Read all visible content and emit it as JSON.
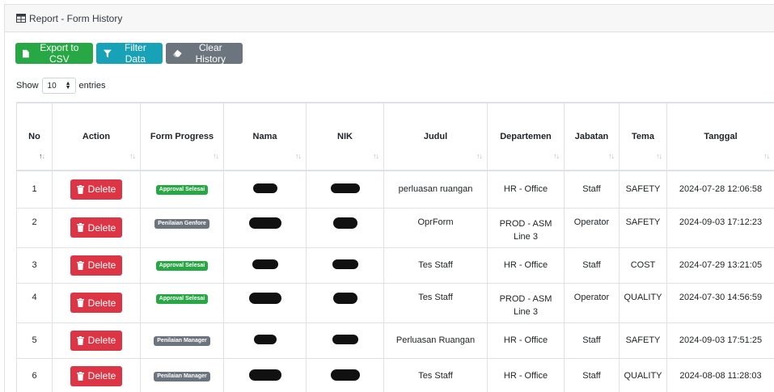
{
  "header": {
    "title": "Report - Form History",
    "icon": "table-icon"
  },
  "toolbar": {
    "export_label": "Export to CSV",
    "filter_label": "Filter Data",
    "clear_label": "Clear History",
    "colors": {
      "export": "#28a745",
      "filter": "#17a2b8",
      "clear": "#6c757d"
    }
  },
  "length": {
    "show": "Show",
    "value": "10",
    "entries": "entries"
  },
  "table": {
    "columns": [
      "No",
      "Action",
      "Form Progress",
      "Nama",
      "NIK",
      "Judul",
      "Departemen",
      "Jabatan",
      "Tema",
      "Tanggal"
    ],
    "delete_label": "Delete",
    "rows": [
      {
        "no": "1",
        "progress": "Approval Selesai",
        "status": "success",
        "judul": "perluasan ruangan",
        "dept1": "HR - Office",
        "dept2": "",
        "jabatan": "Staff",
        "tema": "SAFETY",
        "tanggal": "2024-07-28 12:06:58"
      },
      {
        "no": "2",
        "progress": "Penilaian Genfore",
        "status": "secondary",
        "judul": "OprForm",
        "dept1": "PROD - ASM",
        "dept2": "Line 3",
        "jabatan": "Operator",
        "tema": "SAFETY",
        "tanggal": "2024-09-03 17:12:23"
      },
      {
        "no": "3",
        "progress": "Approval Selesai",
        "status": "success",
        "judul": "Tes Staff",
        "dept1": "HR - Office",
        "dept2": "",
        "jabatan": "Staff",
        "tema": "COST",
        "tanggal": "2024-07-29 13:21:05"
      },
      {
        "no": "4",
        "progress": "Approval Selesai",
        "status": "success",
        "judul": "Tes Staff",
        "dept1": "PROD - ASM",
        "dept2": "Line 3",
        "jabatan": "Operator",
        "tema": "QUALITY",
        "tanggal": "2024-07-30 14:56:59"
      },
      {
        "no": "5",
        "progress": "Penilaian Manager",
        "status": "secondary",
        "judul": "Perluasan Ruangan",
        "dept1": "HR - Office",
        "dept2": "",
        "jabatan": "Staff",
        "tema": "SAFETY",
        "tanggal": "2024-09-03 17:51:25"
      },
      {
        "no": "6",
        "progress": "Penilaian Manager",
        "status": "secondary",
        "judul": "Tes Staff",
        "dept1": "HR - Office",
        "dept2": "",
        "jabatan": "Staff",
        "tema": "QUALITY",
        "tanggal": "2024-08-08 11:28:03"
      }
    ]
  }
}
